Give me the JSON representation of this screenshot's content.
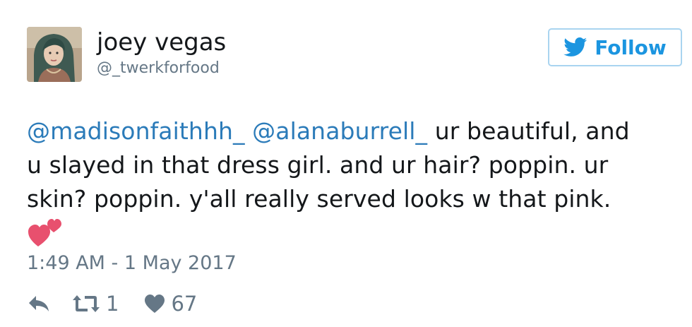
{
  "user": {
    "display_name": "joey vegas",
    "handle": "@_twerkforfood",
    "avatar_icon": "profile-photo"
  },
  "follow_button": {
    "label": "Follow",
    "icon": "twitter-bird-icon",
    "color": "#1b95e0"
  },
  "tweet": {
    "mention_1": "@madisonfaithhh_",
    "mention_2": "@alanaburrell_",
    "text_line_1": " ur beautiful, and",
    "text_line_2": "u slayed in that dress girl. and ur hair? poppin. ur",
    "text_line_3": "skin? poppin. y'all really served looks w that pink.",
    "emoji": "two-hearts-emoji",
    "timestamp": "1:49 AM - 1 May 2017"
  },
  "actions": {
    "reply_icon": "reply-icon",
    "retweet_icon": "retweet-icon",
    "retweet_count": "1",
    "like_icon": "heart-icon",
    "like_count": "67"
  },
  "colors": {
    "mention": "#2b7bb9",
    "secondary_text": "#657786",
    "heart_emoji": "#e8506e"
  }
}
